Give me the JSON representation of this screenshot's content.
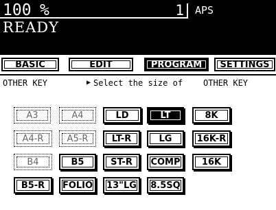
{
  "status": {
    "zoom_value": "100",
    "zoom_unit": "%",
    "copy_count": "1",
    "aps_label": "APS",
    "machine_status": "READY"
  },
  "tabs": {
    "basic": "BASIC",
    "edit": "EDIT",
    "program": "PROGRAM",
    "settings": "SETTINGS",
    "active": "PROGRAM"
  },
  "message": {
    "left": "OTHER KEY",
    "arrow": "▶",
    "center": "Select the size of",
    "right": "OTHER KEY"
  },
  "paper_sizes": {
    "a3": "A3",
    "a4": "A4",
    "ld": "LD",
    "lt": "LT",
    "k8": "8K",
    "a4r": "A4-R",
    "a5r": "A5-R",
    "ltr": "LT-R",
    "lg": "LG",
    "k16r": "16K-R",
    "b4": "B4",
    "b5": "B5",
    "str": "ST-R",
    "comp": "COMP",
    "k16": "16K",
    "b5r": "B5-R",
    "folio": "FOLIO",
    "lg13": "13\"LG",
    "sq85": "8.5SQ",
    "selected": "LT",
    "disabled": [
      "A3",
      "A4",
      "A4-R",
      "A5-R",
      "B4"
    ]
  }
}
